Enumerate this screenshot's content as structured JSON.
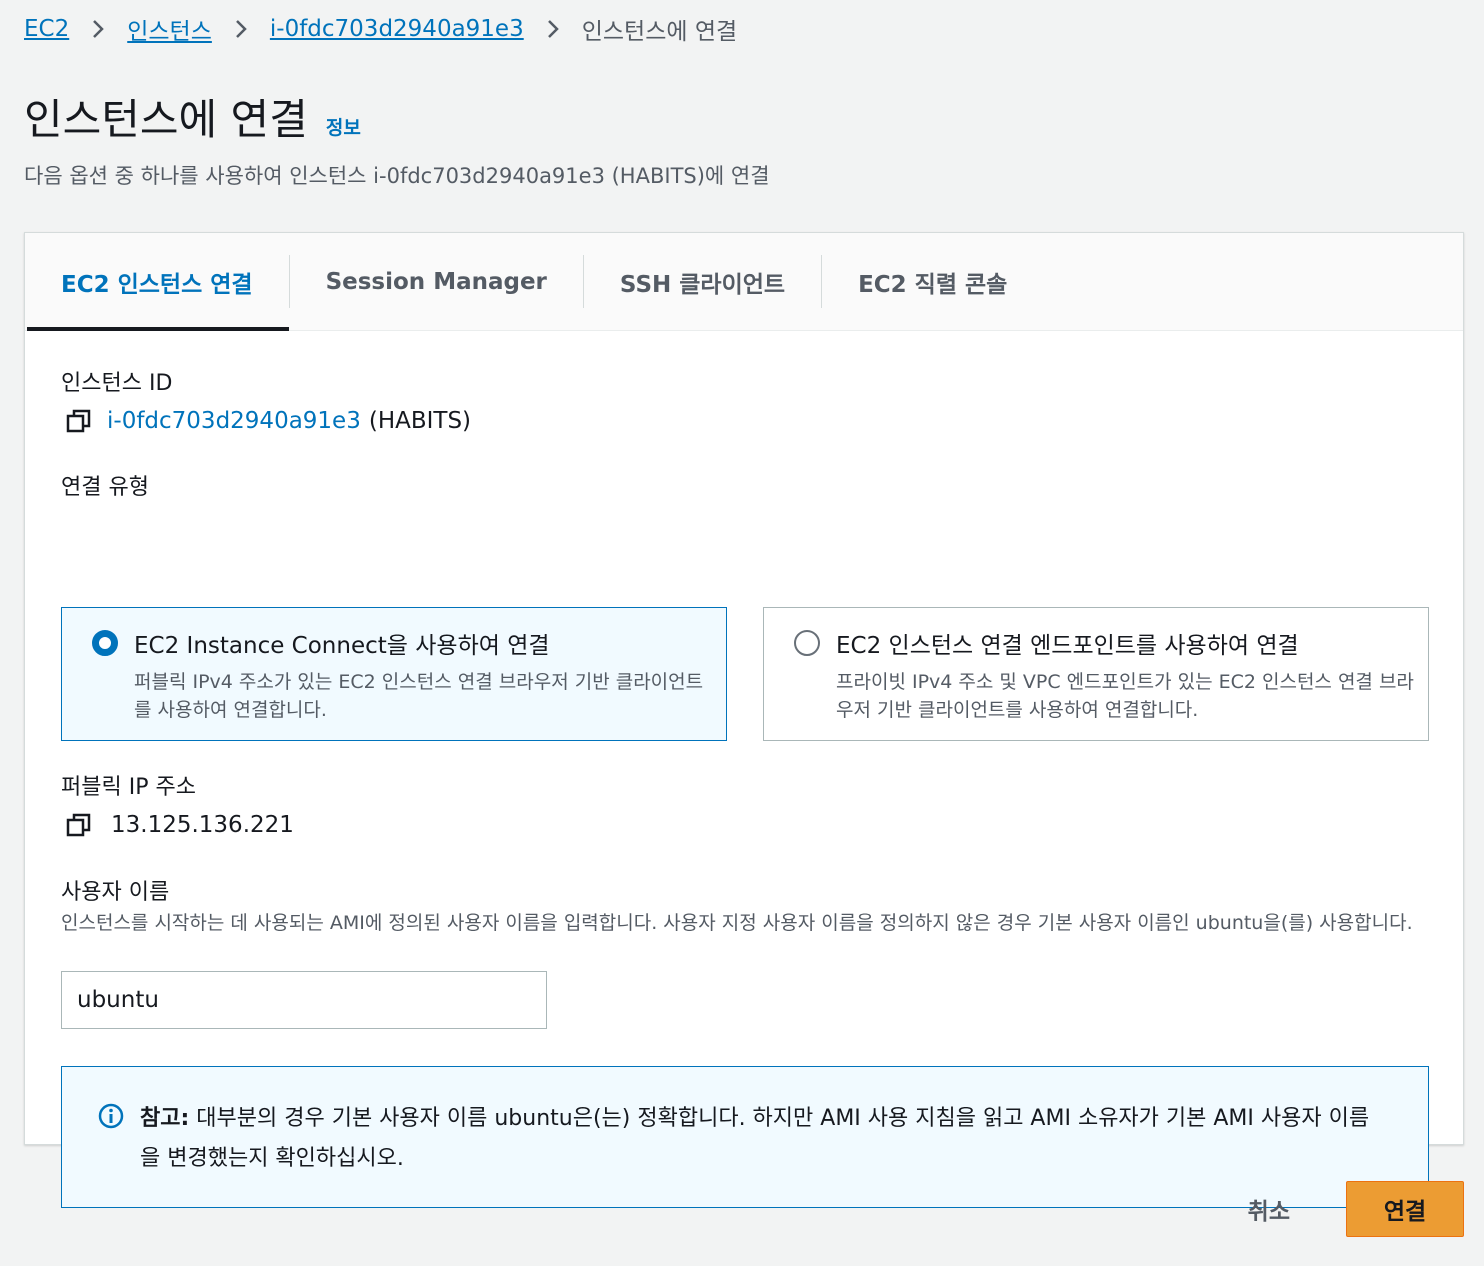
{
  "breadcrumb": {
    "items": [
      "EC2",
      "인스턴스",
      "i-0fdc703d2940a91e3"
    ],
    "current": "인스턴스에 연결"
  },
  "header": {
    "title": "인스턴스에 연결",
    "info_link": "정보",
    "subtitle": "다음 옵션 중 하나를 사용하여 인스턴스 i-0fdc703d2940a91e3 (HABITS)에 연결"
  },
  "tabs": [
    {
      "label": "EC2 인스턴스 연결",
      "active": true
    },
    {
      "label": "Session Manager",
      "active": false
    },
    {
      "label": "SSH 클라이언트",
      "active": false
    },
    {
      "label": "EC2 직렬 콘솔",
      "active": false
    }
  ],
  "instance": {
    "label": "인스턴스 ID",
    "id": "i-0fdc703d2940a91e3",
    "name": "(HABITS)"
  },
  "connection_type": {
    "label": "연결 유형",
    "options": [
      {
        "title": "EC2 Instance Connect을 사용하여 연결",
        "desc": "퍼블릭 IPv4 주소가 있는 EC2 인스턴스 연결 브라우저 기반 클라이언트를 사용하여 연결합니다.",
        "selected": true
      },
      {
        "title": "EC2 인스턴스 연결 엔드포인트를 사용하여 연결",
        "desc": "프라이빗 IPv4 주소 및 VPC 엔드포인트가 있는 EC2 인스턴스 연결 브라우저 기반 클라이언트를 사용하여 연결합니다.",
        "selected": false
      }
    ]
  },
  "public_ip": {
    "label": "퍼블릭 IP 주소",
    "value": "13.125.136.221"
  },
  "username": {
    "label": "사용자 이름",
    "help": "인스턴스를 시작하는 데 사용되는 AMI에 정의된 사용자 이름을 입력합니다. 사용자 지정 사용자 이름을 정의하지 않은 경우 기본 사용자 이름인 ubuntu을(를) 사용합니다.",
    "value": "ubuntu"
  },
  "note": {
    "prefix": "참고:",
    "text": " 대부분의 경우 기본 사용자 이름 ubuntu은(는) 정확합니다. 하지만 AMI 사용 지침을 읽고 AMI 소유자가 기본 AMI 사용자 이름을 변경했는지 확인하십시오."
  },
  "footer": {
    "cancel_label": "취소",
    "connect_label": "연결"
  },
  "colors": {
    "link": "#0073bb",
    "primary_button": "#ec9c33",
    "selected_card_bg": "#f1faff"
  }
}
